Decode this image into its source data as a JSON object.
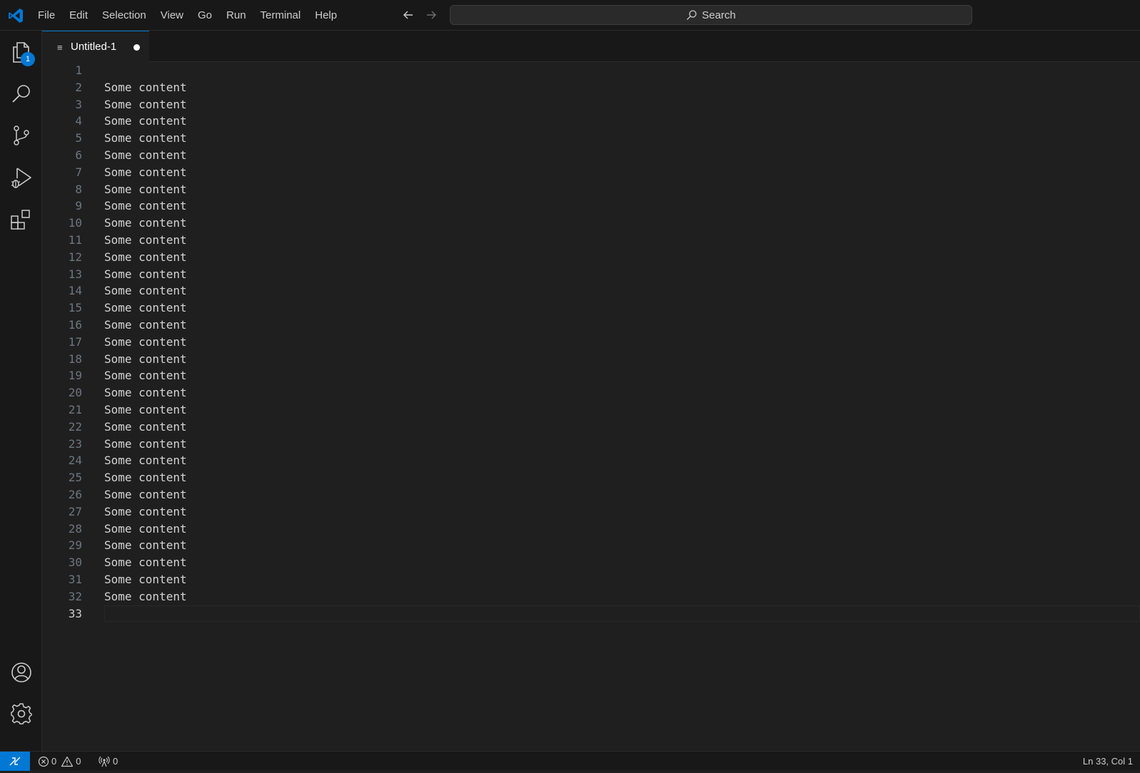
{
  "titlebar": {
    "menu": [
      "File",
      "Edit",
      "Selection",
      "View",
      "Go",
      "Run",
      "Terminal",
      "Help"
    ],
    "search_label": "Search"
  },
  "activitybar": {
    "explorer_badge": "1"
  },
  "tabs": [
    {
      "label": "Untitled-1",
      "dirty": true,
      "active": true
    }
  ],
  "editor": {
    "lines": [
      {
        "num": "1",
        "text": ""
      },
      {
        "num": "2",
        "text": "Some content"
      },
      {
        "num": "3",
        "text": "Some content"
      },
      {
        "num": "4",
        "text": "Some content"
      },
      {
        "num": "5",
        "text": "Some content"
      },
      {
        "num": "6",
        "text": "Some content"
      },
      {
        "num": "7",
        "text": "Some content"
      },
      {
        "num": "8",
        "text": "Some content"
      },
      {
        "num": "9",
        "text": "Some content"
      },
      {
        "num": "10",
        "text": "Some content"
      },
      {
        "num": "11",
        "text": "Some content"
      },
      {
        "num": "12",
        "text": "Some content"
      },
      {
        "num": "13",
        "text": "Some content"
      },
      {
        "num": "14",
        "text": "Some content"
      },
      {
        "num": "15",
        "text": "Some content"
      },
      {
        "num": "16",
        "text": "Some content"
      },
      {
        "num": "17",
        "text": "Some content"
      },
      {
        "num": "18",
        "text": "Some content"
      },
      {
        "num": "19",
        "text": "Some content"
      },
      {
        "num": "20",
        "text": "Some content"
      },
      {
        "num": "21",
        "text": "Some content"
      },
      {
        "num": "22",
        "text": "Some content"
      },
      {
        "num": "23",
        "text": "Some content"
      },
      {
        "num": "24",
        "text": "Some content"
      },
      {
        "num": "25",
        "text": "Some content"
      },
      {
        "num": "26",
        "text": "Some content"
      },
      {
        "num": "27",
        "text": "Some content"
      },
      {
        "num": "28",
        "text": "Some content"
      },
      {
        "num": "29",
        "text": "Some content"
      },
      {
        "num": "30",
        "text": "Some content"
      },
      {
        "num": "31",
        "text": "Some content"
      },
      {
        "num": "32",
        "text": "Some content"
      },
      {
        "num": "33",
        "text": ""
      }
    ],
    "current_line": "33"
  },
  "statusbar": {
    "errors": "0",
    "warnings": "0",
    "ports": "0",
    "cursor_position": "Ln 33, Col 1"
  },
  "colors": {
    "accent": "#0078d4",
    "background": "#1f1f1f",
    "chrome": "#181818"
  }
}
